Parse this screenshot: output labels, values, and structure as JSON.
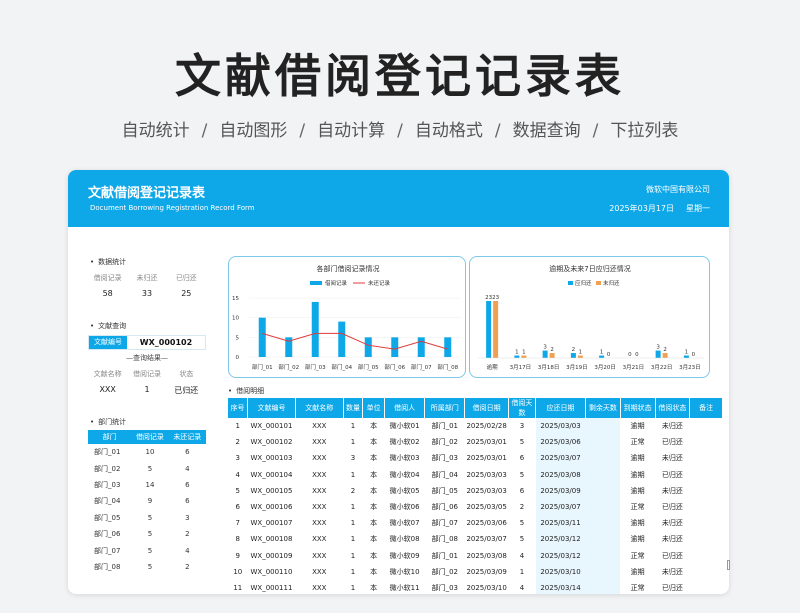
{
  "hero": {
    "title": "文献借阅登记记录表",
    "features": [
      "自动统计",
      "自动图形",
      "自动计算",
      "自动格式",
      "数据查询",
      "下拉列表"
    ],
    "separator": "/"
  },
  "header": {
    "title": "文献借阅登记记录表",
    "subtitle": "Document Borrowing Registration Record Form",
    "company": "微软中国有限公司",
    "date": "2025年03月17日",
    "weekday": "星期一"
  },
  "stats": {
    "section_title": "数据统计",
    "labels": [
      "借阅记录",
      "未归还",
      "已归还"
    ],
    "values": [
      "58",
      "33",
      "25"
    ]
  },
  "query": {
    "section_title": "文献查询",
    "field_label": "文献编号",
    "field_value": "WX_000102",
    "result_title": "—查询结果—",
    "result_labels": [
      "文献名称",
      "借阅记录",
      "状态"
    ],
    "result_values": [
      "XXX",
      "1",
      "已归还"
    ]
  },
  "dept_stats": {
    "section_title": "部门统计",
    "headers": [
      "部门",
      "借阅记录",
      "未还记录"
    ],
    "rows": [
      [
        "部门_01",
        "10",
        "6"
      ],
      [
        "部门_02",
        "5",
        "4"
      ],
      [
        "部门_03",
        "14",
        "6"
      ],
      [
        "部门_04",
        "9",
        "6"
      ],
      [
        "部门_05",
        "5",
        "3"
      ],
      [
        "部门_06",
        "5",
        "2"
      ],
      [
        "部门_07",
        "5",
        "4"
      ],
      [
        "部门_08",
        "5",
        "2"
      ]
    ]
  },
  "colors": {
    "accent": "#0ea8e8",
    "orange": "#f0a050",
    "red": "#e03a3a",
    "highlight": "#e8f6fd"
  },
  "chart_data": [
    {
      "type": "bar",
      "title": "各部门借阅记录情况",
      "categories": [
        "部门_01",
        "部门_02",
        "部门_03",
        "部门_04",
        "部门_05",
        "部门_06",
        "部门_07",
        "部门_08"
      ],
      "series": [
        {
          "name": "借阅记录",
          "type": "bar",
          "values": [
            10,
            5,
            14,
            9,
            5,
            5,
            5,
            5
          ]
        },
        {
          "name": "未还记录",
          "type": "line",
          "values": [
            6,
            4,
            6,
            6,
            3,
            2,
            4,
            2
          ]
        }
      ],
      "yticks": [
        0,
        5,
        10,
        15
      ],
      "ylim": [
        0,
        15
      ],
      "legend": "top"
    },
    {
      "type": "bar",
      "title": "逾期及未来7日应归还情况",
      "categories": [
        "逾期",
        "3月17日",
        "3月18日",
        "3月19日",
        "3月20日",
        "3月21日",
        "3月22日",
        "3月23日"
      ],
      "series": [
        {
          "name": "应归还",
          "values": [
            23,
            1,
            3,
            2,
            1,
            0,
            3,
            1
          ]
        },
        {
          "name": "未归还",
          "values": [
            23,
            1,
            2,
            1,
            0,
            0,
            2,
            0
          ]
        }
      ],
      "legend": "top"
    }
  ],
  "detail": {
    "section_title": "借阅明细",
    "headers": [
      "序号",
      "文献编号",
      "文献名称",
      "数量",
      "单位",
      "借阅人",
      "所属部门",
      "借阅日期",
      "借阅天数",
      "应还日期",
      "剩余天数",
      "到期状态",
      "借阅状态",
      "备注"
    ],
    "rows": [
      [
        "1",
        "WX_000101",
        "XXX",
        "1",
        "本",
        "微小软01",
        "部门_01",
        "2025/02/28",
        "3",
        "2025/03/03",
        "",
        "逾期",
        "未归还",
        ""
      ],
      [
        "2",
        "WX_000102",
        "XXX",
        "1",
        "本",
        "微小软02",
        "部门_02",
        "2025/03/01",
        "5",
        "2025/03/06",
        "",
        "正常",
        "已归还",
        ""
      ],
      [
        "3",
        "WX_000103",
        "XXX",
        "3",
        "本",
        "微小软03",
        "部门_03",
        "2025/03/01",
        "6",
        "2025/03/07",
        "",
        "逾期",
        "未归还",
        ""
      ],
      [
        "4",
        "WX_000104",
        "XXX",
        "1",
        "本",
        "微小软04",
        "部门_04",
        "2025/03/03",
        "5",
        "2025/03/08",
        "",
        "逾期",
        "已归还",
        ""
      ],
      [
        "5",
        "WX_000105",
        "XXX",
        "2",
        "本",
        "微小软05",
        "部门_05",
        "2025/03/03",
        "6",
        "2025/03/09",
        "",
        "逾期",
        "未归还",
        ""
      ],
      [
        "6",
        "WX_000106",
        "XXX",
        "1",
        "本",
        "微小软06",
        "部门_06",
        "2025/03/05",
        "2",
        "2025/03/07",
        "",
        "正常",
        "已归还",
        ""
      ],
      [
        "7",
        "WX_000107",
        "XXX",
        "1",
        "本",
        "微小软07",
        "部门_07",
        "2025/03/06",
        "5",
        "2025/03/11",
        "",
        "逾期",
        "未归还",
        ""
      ],
      [
        "8",
        "WX_000108",
        "XXX",
        "1",
        "本",
        "微小软08",
        "部门_08",
        "2025/03/07",
        "5",
        "2025/03/12",
        "",
        "逾期",
        "未归还",
        ""
      ],
      [
        "9",
        "WX_000109",
        "XXX",
        "1",
        "本",
        "微小软09",
        "部门_01",
        "2025/03/08",
        "4",
        "2025/03/12",
        "",
        "正常",
        "已归还",
        ""
      ],
      [
        "10",
        "WX_000110",
        "XXX",
        "1",
        "本",
        "微小软10",
        "部门_02",
        "2025/03/09",
        "1",
        "2025/03/10",
        "",
        "逾期",
        "未归还",
        ""
      ],
      [
        "11",
        "WX_000111",
        "XXX",
        "1",
        "本",
        "微小软11",
        "部门_03",
        "2025/03/10",
        "4",
        "2025/03/14",
        "",
        "正常",
        "已归还",
        ""
      ]
    ]
  }
}
